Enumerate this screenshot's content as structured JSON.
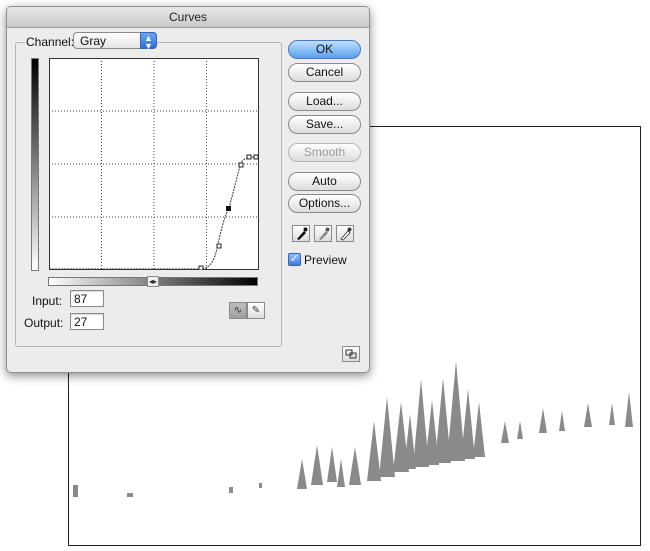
{
  "dialog": {
    "title": "Curves",
    "channel_label": "Channel:",
    "channel_value": "Gray",
    "input_label": "Input:",
    "input_value": "87",
    "output_label": "Output:",
    "output_value": "27",
    "preview_label": "Preview",
    "preview_checked": true
  },
  "buttons": {
    "ok": "OK",
    "cancel": "Cancel",
    "load": "Load...",
    "save": "Save...",
    "smooth": "Smooth",
    "auto": "Auto",
    "options": "Options..."
  },
  "colors": {
    "accent": "#3a7ee0",
    "trees": "#8a8a8a"
  },
  "icons": {
    "curve_tool": "curve-point-icon",
    "pencil_tool": "pencil-icon",
    "black_eyedropper": "black-eyedropper-icon",
    "gray_eyedropper": "gray-eyedropper-icon",
    "white_eyedropper": "white-eyedropper-icon",
    "expand": "expand-view-icon"
  }
}
